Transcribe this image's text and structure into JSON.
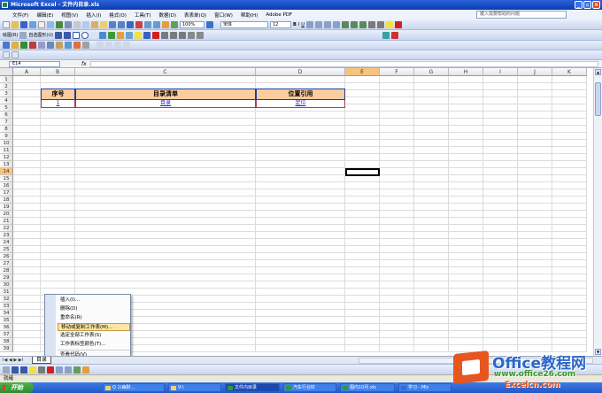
{
  "window": {
    "title": "Microsoft Excel - 文件内目录.xls"
  },
  "menu": [
    "文件(F)",
    "编辑(E)",
    "视图(V)",
    "插入(I)",
    "格式(O)",
    "工具(T)",
    "数据(D)",
    "表表单(Q)",
    "窗口(W)",
    "帮助(H)",
    "Adobe PDF"
  ],
  "help": {
    "placeholder": "键入需要帮助的问题"
  },
  "toolbar": {
    "font": "宋体",
    "size": "12",
    "zoom": "100%",
    "draw_label": "绘图(R)",
    "autoshape_label": "自选图形(U)"
  },
  "formula": {
    "namebox": "E14",
    "fx": "fx"
  },
  "columns": [
    "A",
    "B",
    "C",
    "D",
    "E",
    "F",
    "G",
    "H",
    "I",
    "J",
    "K"
  ],
  "selected_column": "E",
  "selected_row": "14",
  "rows": [
    "1",
    "2",
    "3",
    "4",
    "5",
    "6",
    "7",
    "8",
    "9",
    "10",
    "11",
    "12",
    "13",
    "14",
    "15",
    "16",
    "17",
    "18",
    "19",
    "20",
    "21",
    "22",
    "23",
    "24",
    "25",
    "26",
    "27",
    "28",
    "29",
    "30",
    "31",
    "32",
    "33",
    "34",
    "35",
    "36",
    "37",
    "38",
    "39"
  ],
  "table": {
    "headers": [
      "序号",
      "目录清单",
      "位置引用"
    ],
    "row": [
      "1",
      "目录",
      "定位"
    ]
  },
  "context_menu": [
    "插入(I)...",
    "删除(D)",
    "重命名(R)",
    "移动或复制工作表(M)...",
    "选定全部工作表(S)",
    "工作表标签颜色(T)...",
    "查看代码(V)"
  ],
  "context_menu_highlight": 3,
  "sheet": {
    "tab": "目录",
    "nav": "I◀ ◀ ▶ ▶I"
  },
  "status": {
    "text": "就绪"
  },
  "taskbar": {
    "start": "开始",
    "tasks": [
      "Q 1(幽默...",
      "9:\\",
      "文件内目录",
      "汽车行业好",
      "图内10月.xls",
      "学习 - Mic"
    ]
  },
  "watermark": {
    "title": "Office教程网",
    "url": "www.office26.com",
    "url2": "Excelcn.com"
  }
}
